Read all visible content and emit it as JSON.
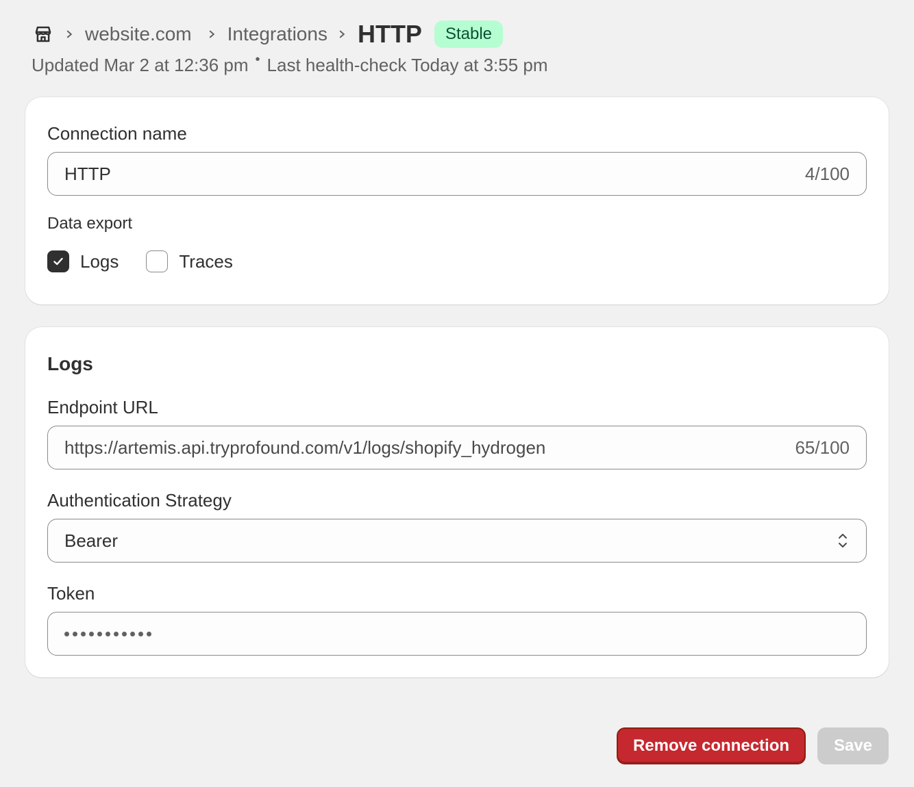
{
  "header": {
    "breadcrumb": {
      "home_icon": "store-icon",
      "store": "website.com",
      "section": "Integrations",
      "current": "HTTP"
    },
    "badge": "Stable",
    "updated": "Updated Mar 2 at 12:36 pm",
    "health_check": "Last health-check Today at 3:55 pm"
  },
  "connection": {
    "name_label": "Connection name",
    "name_value": "HTTP",
    "name_counter": "4/100",
    "data_export_label": "Data export",
    "options": [
      {
        "label": "Logs",
        "checked": true
      },
      {
        "label": "Traces",
        "checked": false
      }
    ]
  },
  "logs": {
    "title": "Logs",
    "endpoint_label": "Endpoint URL",
    "endpoint_value": "https://artemis.api.tryprofound.com/v1/logs/shopify_hydrogen",
    "endpoint_counter": "65/100",
    "auth_label": "Authentication Strategy",
    "auth_value": "Bearer",
    "token_label": "Token",
    "token_masked_length": 11
  },
  "actions": {
    "remove_label": "Remove connection",
    "save_label": "Save"
  },
  "colors": {
    "background": "#f1f1f1",
    "badge_bg": "#b4fed2",
    "badge_text": "#0c5132",
    "danger": "#c5282f",
    "disabled": "#cccccc"
  }
}
